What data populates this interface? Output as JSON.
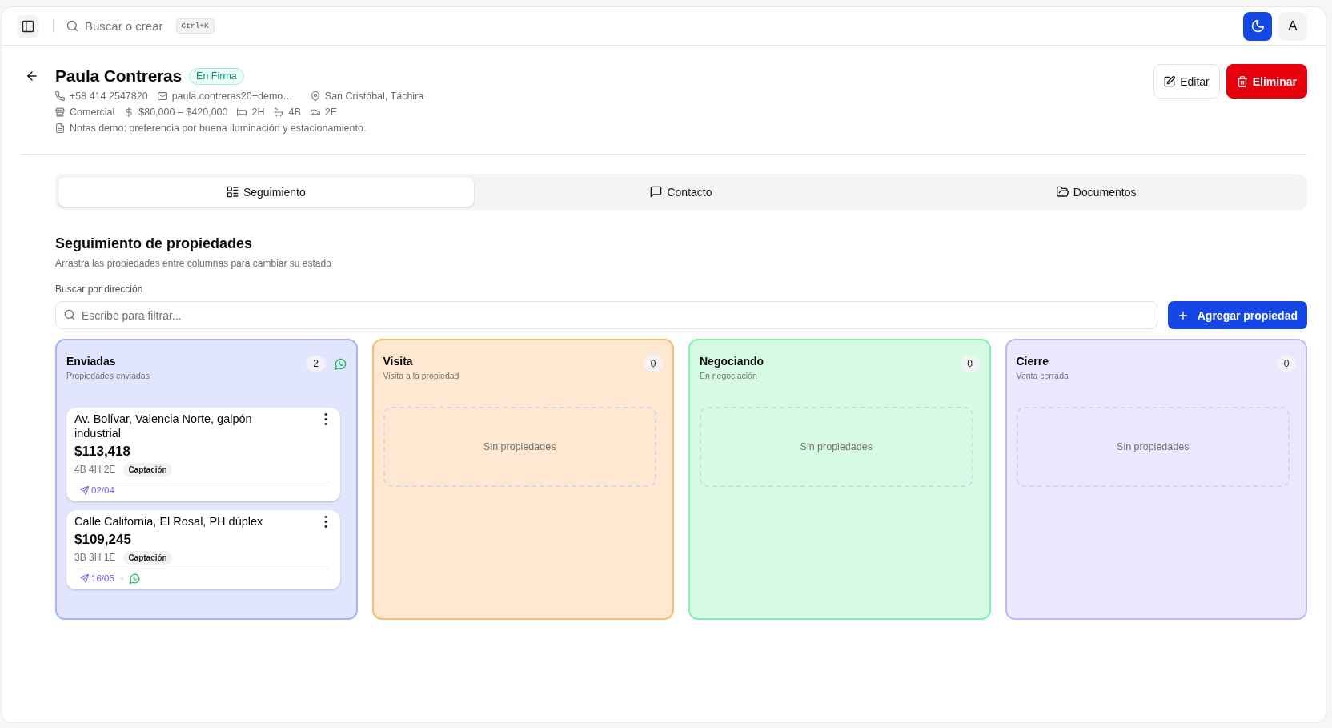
{
  "topbar": {
    "search": "Buscar o crear",
    "shortcut": "Ctrl+K",
    "avatar": "A"
  },
  "contact": {
    "name": "Paula Contreras",
    "status": "En Firma",
    "detail_rows": [
      {
        "items": [
          {
            "kind": "phone",
            "text": "+58 414 2547820"
          },
          {
            "kind": "email",
            "text": "paula.contreras20+demo…"
          },
          {
            "kind": "location",
            "text": "San Cristóbal, Táchira"
          }
        ]
      },
      {
        "items": [
          {
            "kind": "property_type",
            "text": "Comercial"
          },
          {
            "kind": "budget",
            "text": "$80,000 – $420,000"
          },
          {
            "kind": "bedrooms",
            "text": "2H"
          },
          {
            "kind": "bathrooms",
            "text": "4B"
          },
          {
            "kind": "parking",
            "text": "2E"
          }
        ]
      },
      {
        "items": [
          {
            "kind": "notes",
            "text": "Notas demo: preferencia por buena iluminación y estacionamiento."
          }
        ]
      }
    ]
  },
  "actions": [
    {
      "label": "Editar",
      "kind": "secondary"
    },
    {
      "label": "Eliminar",
      "kind": "danger"
    }
  ],
  "tabs": [
    {
      "label": "Seguimiento",
      "selected": true
    },
    {
      "label": "Contacto",
      "selected": false
    },
    {
      "label": "Documentos",
      "selected": false
    }
  ],
  "tracking": {
    "title": "Seguimiento de propiedades",
    "subtitle": "Arrastra las propiedades entre columnas para cambiar su estado",
    "filter": {
      "label": "Buscar por dirección",
      "placeholder": "Escribe para filtrar..."
    },
    "add_button": "Agregar propiedad",
    "columns": [
      {
        "title": "Enviadas",
        "subtitle": "Propiedades enviadas",
        "count": "2",
        "color": "#a5b4fc",
        "whatsapp": true,
        "cards": [
          {
            "title": "Av. Bolívar, Valencia Norte, galpón industrial",
            "price": "$113,418",
            "specs": "4B 4H 2E",
            "tag": "Captación",
            "sent": "02/04",
            "whatsapp": false
          },
          {
            "title": "Calle California, El Rosal, PH dúplex",
            "price": "$109,245",
            "specs": "3B 3H 1E",
            "tag": "Captación",
            "sent": "16/05",
            "whatsapp": true
          }
        ]
      },
      {
        "title": "Visita",
        "subtitle": "Visita a la propiedad",
        "count": "0",
        "color": "#fdba74",
        "whatsapp": false,
        "empty_text": "Sin propiedades"
      },
      {
        "title": "Negociando",
        "subtitle": "En negociación",
        "count": "0",
        "color": "#86efac",
        "whatsapp": false,
        "empty_text": "Sin propiedades"
      },
      {
        "title": "Cierre",
        "subtitle": "Venta cerrada",
        "count": "0",
        "color": "#c4b5fd",
        "whatsapp": false,
        "empty_text": "Sin propiedades"
      }
    ]
  }
}
